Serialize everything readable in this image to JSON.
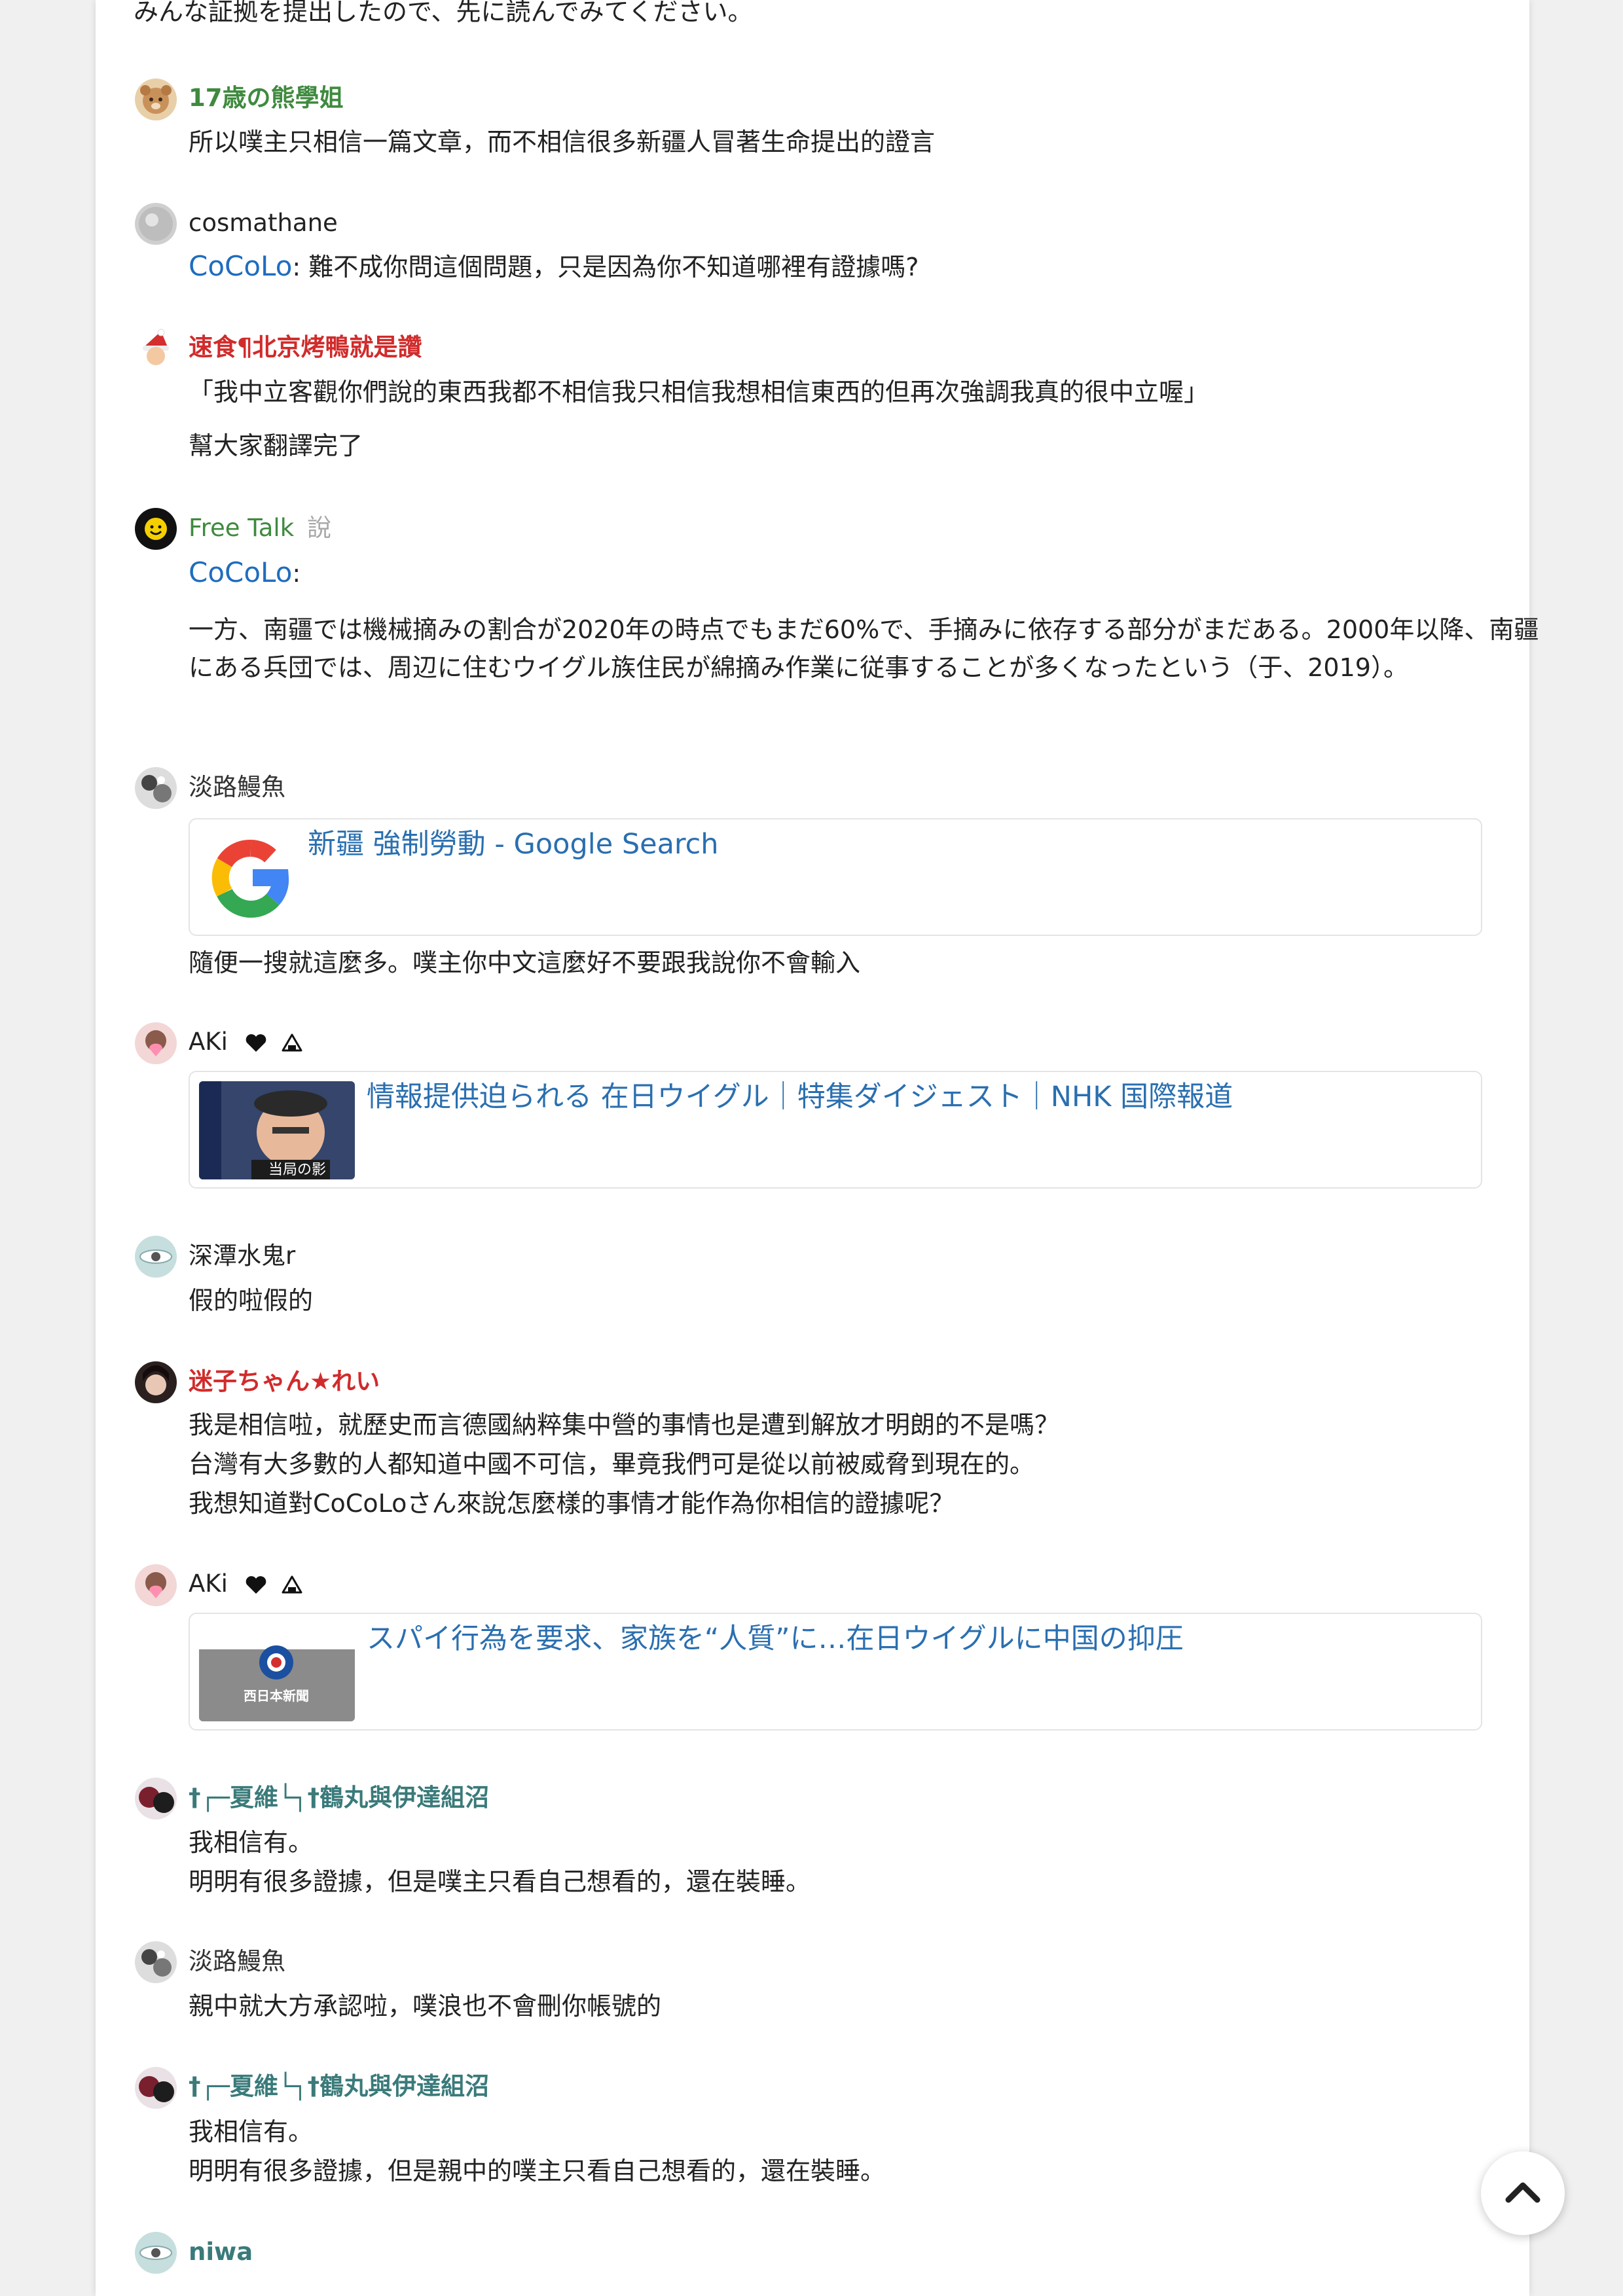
{
  "colors": {
    "mention": "#1f6dbf",
    "link_title": "#2a6fb0",
    "green_name": "#3f8a3f",
    "red_name": "#d12b2b",
    "teal_name": "#3a7a7a",
    "verb": "#a8a8a8"
  },
  "intro_text": "みんな証拠を提出したので、先に読んでみてください。",
  "comments": [
    {
      "user": "17歳の熊學姐",
      "lines": [
        "所以噗主只相信一篇文章，而不相信很多新疆人冒著生命提出的證言"
      ]
    },
    {
      "user": "cosmathane",
      "mention": "CoCoLo",
      "lines": [
        ": 難不成你問這個問題，只是因為你不知道哪裡有證據嗎?"
      ]
    },
    {
      "user": "速食¶北京烤鴨就是讚",
      "lines": [
        "「我中立客觀你們說的東西我都不相信我只相信我想相信東西的但再次強調我真的很中立喔」",
        "幫大家翻譯完了"
      ]
    },
    {
      "user": "Free Talk",
      "verb": "說",
      "mention": "CoCoLo",
      "lines": [
        ":",
        "一方、南疆では機械摘みの割合が2020年の時点でもまだ60%で、手摘みに依存する部分がまだある。2000年以降、南疆にある兵団では、周辺に住むウイグル族住民が綿摘み作業に従事することが多くなったという（于、2019）。"
      ]
    },
    {
      "user": "淡路鰻魚",
      "link": {
        "title": "新疆 強制勞動 - Google Search",
        "icon": "google-logo"
      },
      "lines": [
        "隨便一搜就這麼多。噗主你中文這麼好不要跟我說你不會輸入"
      ]
    },
    {
      "user": "AKi",
      "user_icons": [
        "heart-icon",
        "onigiri-icon"
      ],
      "link": {
        "title": "情報提供迫られる 在日ウイグル｜特集ダイジェスト｜NHK 国際報道",
        "thumb_caption": "当局の影"
      }
    },
    {
      "user": "深潭水鬼r",
      "lines": [
        "假的啦假的"
      ]
    },
    {
      "user": "迷子ちゃん★れい",
      "lines": [
        "我是相信啦，就歷史而言德國納粹集中營的事情也是遭到解放才明朗的不是嗎？",
        "台灣有大多數的人都知道中國不可信，畢竟我們可是從以前被威脅到現在的。",
        "我想知道對CoCoLoさん來說怎麼樣的事情才能作為你相信的證據呢？"
      ]
    },
    {
      "user": "AKi",
      "user_icons": [
        "heart-icon",
        "onigiri-icon"
      ],
      "link": {
        "title": "スパイ行為を要求、家族を“人質”に…在日ウイグルに中国の抑圧",
        "thumb_caption": "西日本新聞"
      }
    },
    {
      "user": "†┌─夏維└┐†鶴丸與伊達組沼",
      "lines": [
        "我相信有。",
        "明明有很多證據，但是噗主只看自己想看的，還在裝睡。"
      ]
    },
    {
      "user": "淡路鰻魚",
      "lines": [
        "親中就大方承認啦，噗浪也不會刪你帳號的"
      ]
    },
    {
      "user": "†┌─夏維└┐†鶴丸與伊達組沼",
      "lines": [
        "我相信有。",
        "明明有很多證據，但是親中的噗主只看自己想看的，還在裝睡。"
      ]
    },
    {
      "user": "niwa"
    }
  ],
  "scroll_top_icon": "chevron-up-icon"
}
